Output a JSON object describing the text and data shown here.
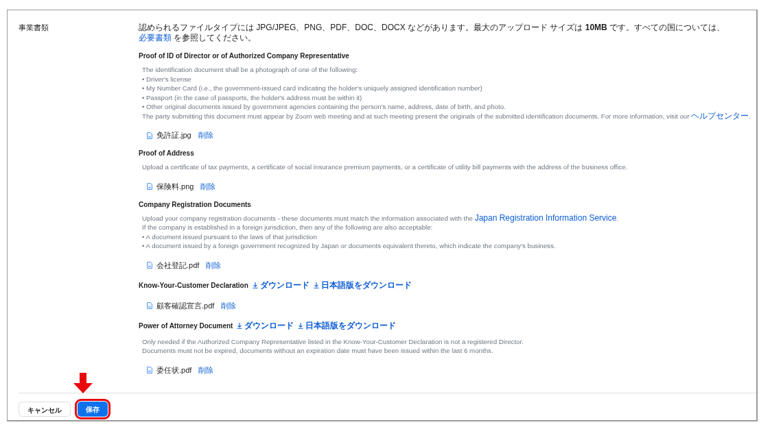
{
  "field_label": "事業書類",
  "intro": {
    "text": "認められるファイルタイプには JPG/JPEG、PNG、PDF、DOC、DOCX などがあります。最大のアップロード サイズは **10MB** です。すべての国については、",
    "link": "必要書類",
    "tail": " を参照してください。"
  },
  "sections": [
    {
      "title": "Proof of ID of Director or of Authorized Company Representative",
      "lines": [
        {
          "text": "The identification document shall be a photograph of one of the following:"
        },
        {
          "text": "• Driver's license"
        },
        {
          "text": "• My Number Card (i.e., the government-issued card indicating the holder's uniquely assigned identification number)"
        },
        {
          "text": "• Passport (in the case of passports, the holder's address must be within it)"
        },
        {
          "text": "• Other original documents issued by government agencies containing the person's name, address, date of birth, and photo."
        },
        {
          "text": "The party submitting this document must appear by Zoom web meeting and at such meeting present the originals of the submitted identification documents. For more information, visit our ",
          "link": "ヘルプセンター",
          "tail": "."
        }
      ],
      "file": "免許証.jpg",
      "delete": "削除"
    },
    {
      "title": "Proof of Address",
      "lines": [
        {
          "text": "Upload a certificate of tax payments, a certificate of social insurance premium payments, or a certificate of utility bill payments with the address of the business office."
        }
      ],
      "file": "保険料.png",
      "delete": "削除"
    },
    {
      "title": "Company Registration Documents",
      "lines": [
        {
          "text": "Upload your company registration documents - these documents must match the information associated with the ",
          "link": "Japan Registration Information Service",
          "tail": "."
        },
        {
          "text": "If the company is established in a foreign jurisdiction, then any of the following are also acceptable:"
        },
        {
          "text": "• A document issued pursuant to the laws of that jurisdiction"
        },
        {
          "text": "• A document issued by a foreign government recognized by Japan or documents equivalent thereto, which indicate the company's business."
        }
      ],
      "file": "会社登記.pdf",
      "delete": "削除"
    },
    {
      "title": "Know-Your-Customer Declaration",
      "downloads": [
        "ダウンロード",
        "日本語版をダウンロード"
      ],
      "file": "顧客確認宣言.pdf",
      "delete": "削除"
    },
    {
      "title": "Power of Attorney Document",
      "downloads": [
        "ダウンロード",
        "日本語版をダウンロード"
      ],
      "lines": [
        {
          "text": "Only needed if the Authorized Company Representative listed in the Know-Your-Customer Declaration is not a registered Director."
        },
        {
          "text": "Documents must not be expired, documents without an expiration date must have been issued within the last 6 months."
        }
      ],
      "file": "委任状.pdf",
      "delete": "削除"
    }
  ],
  "buttons": [
    {
      "label": "キャンセル",
      "kind": "secondary"
    },
    {
      "label": "保存",
      "kind": "primary"
    }
  ]
}
